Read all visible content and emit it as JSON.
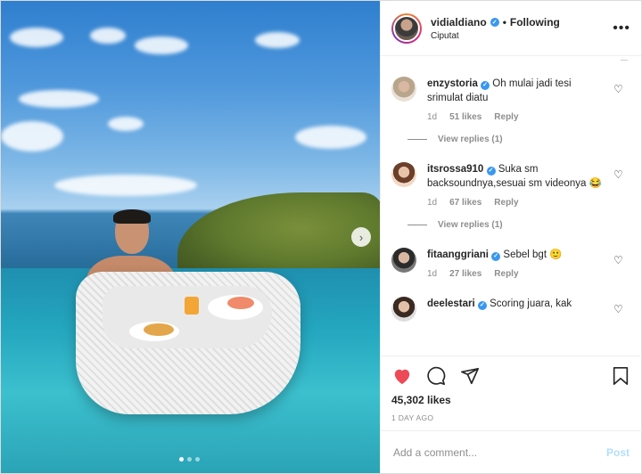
{
  "post": {
    "username": "vidialdiano",
    "separator": "•",
    "follow_state": "Following",
    "location": "Ciputat",
    "likes": "45,302 likes",
    "time_ago": "1 DAY AGO"
  },
  "comments": [
    {
      "username": "enzystoria",
      "text": "Oh mulai jadi tesi srimulat diatu",
      "age": "1d",
      "likes": "51 likes",
      "reply_label": "Reply",
      "view_replies": "View replies (1)"
    },
    {
      "username": "itsrossa910",
      "text": "Suka sm backsoundnya,sesuai sm videonya 😂",
      "age": "1d",
      "likes": "67 likes",
      "reply_label": "Reply",
      "view_replies": "View replies (1)"
    },
    {
      "username": "fitaanggriani",
      "text": "Sebel bgt 🙂",
      "age": "1d",
      "likes": "27 likes",
      "reply_label": "Reply"
    },
    {
      "username": "deelestari",
      "text": "Scoring juara, kak"
    }
  ],
  "add_comment": {
    "placeholder": "Add a comment...",
    "post_label": "Post"
  },
  "icons": {
    "more": "more-options-icon",
    "verified": "verified-badge-icon",
    "like": "heart-filled-icon",
    "comment": "comment-bubble-icon",
    "share": "paper-plane-icon",
    "save": "bookmark-icon",
    "next": "chevron-right-icon"
  },
  "colors": {
    "like_red": "#ed4956",
    "verified_blue": "#3897f0",
    "post_disabled": "#b2dffc",
    "muted": "#8e8e8e"
  }
}
